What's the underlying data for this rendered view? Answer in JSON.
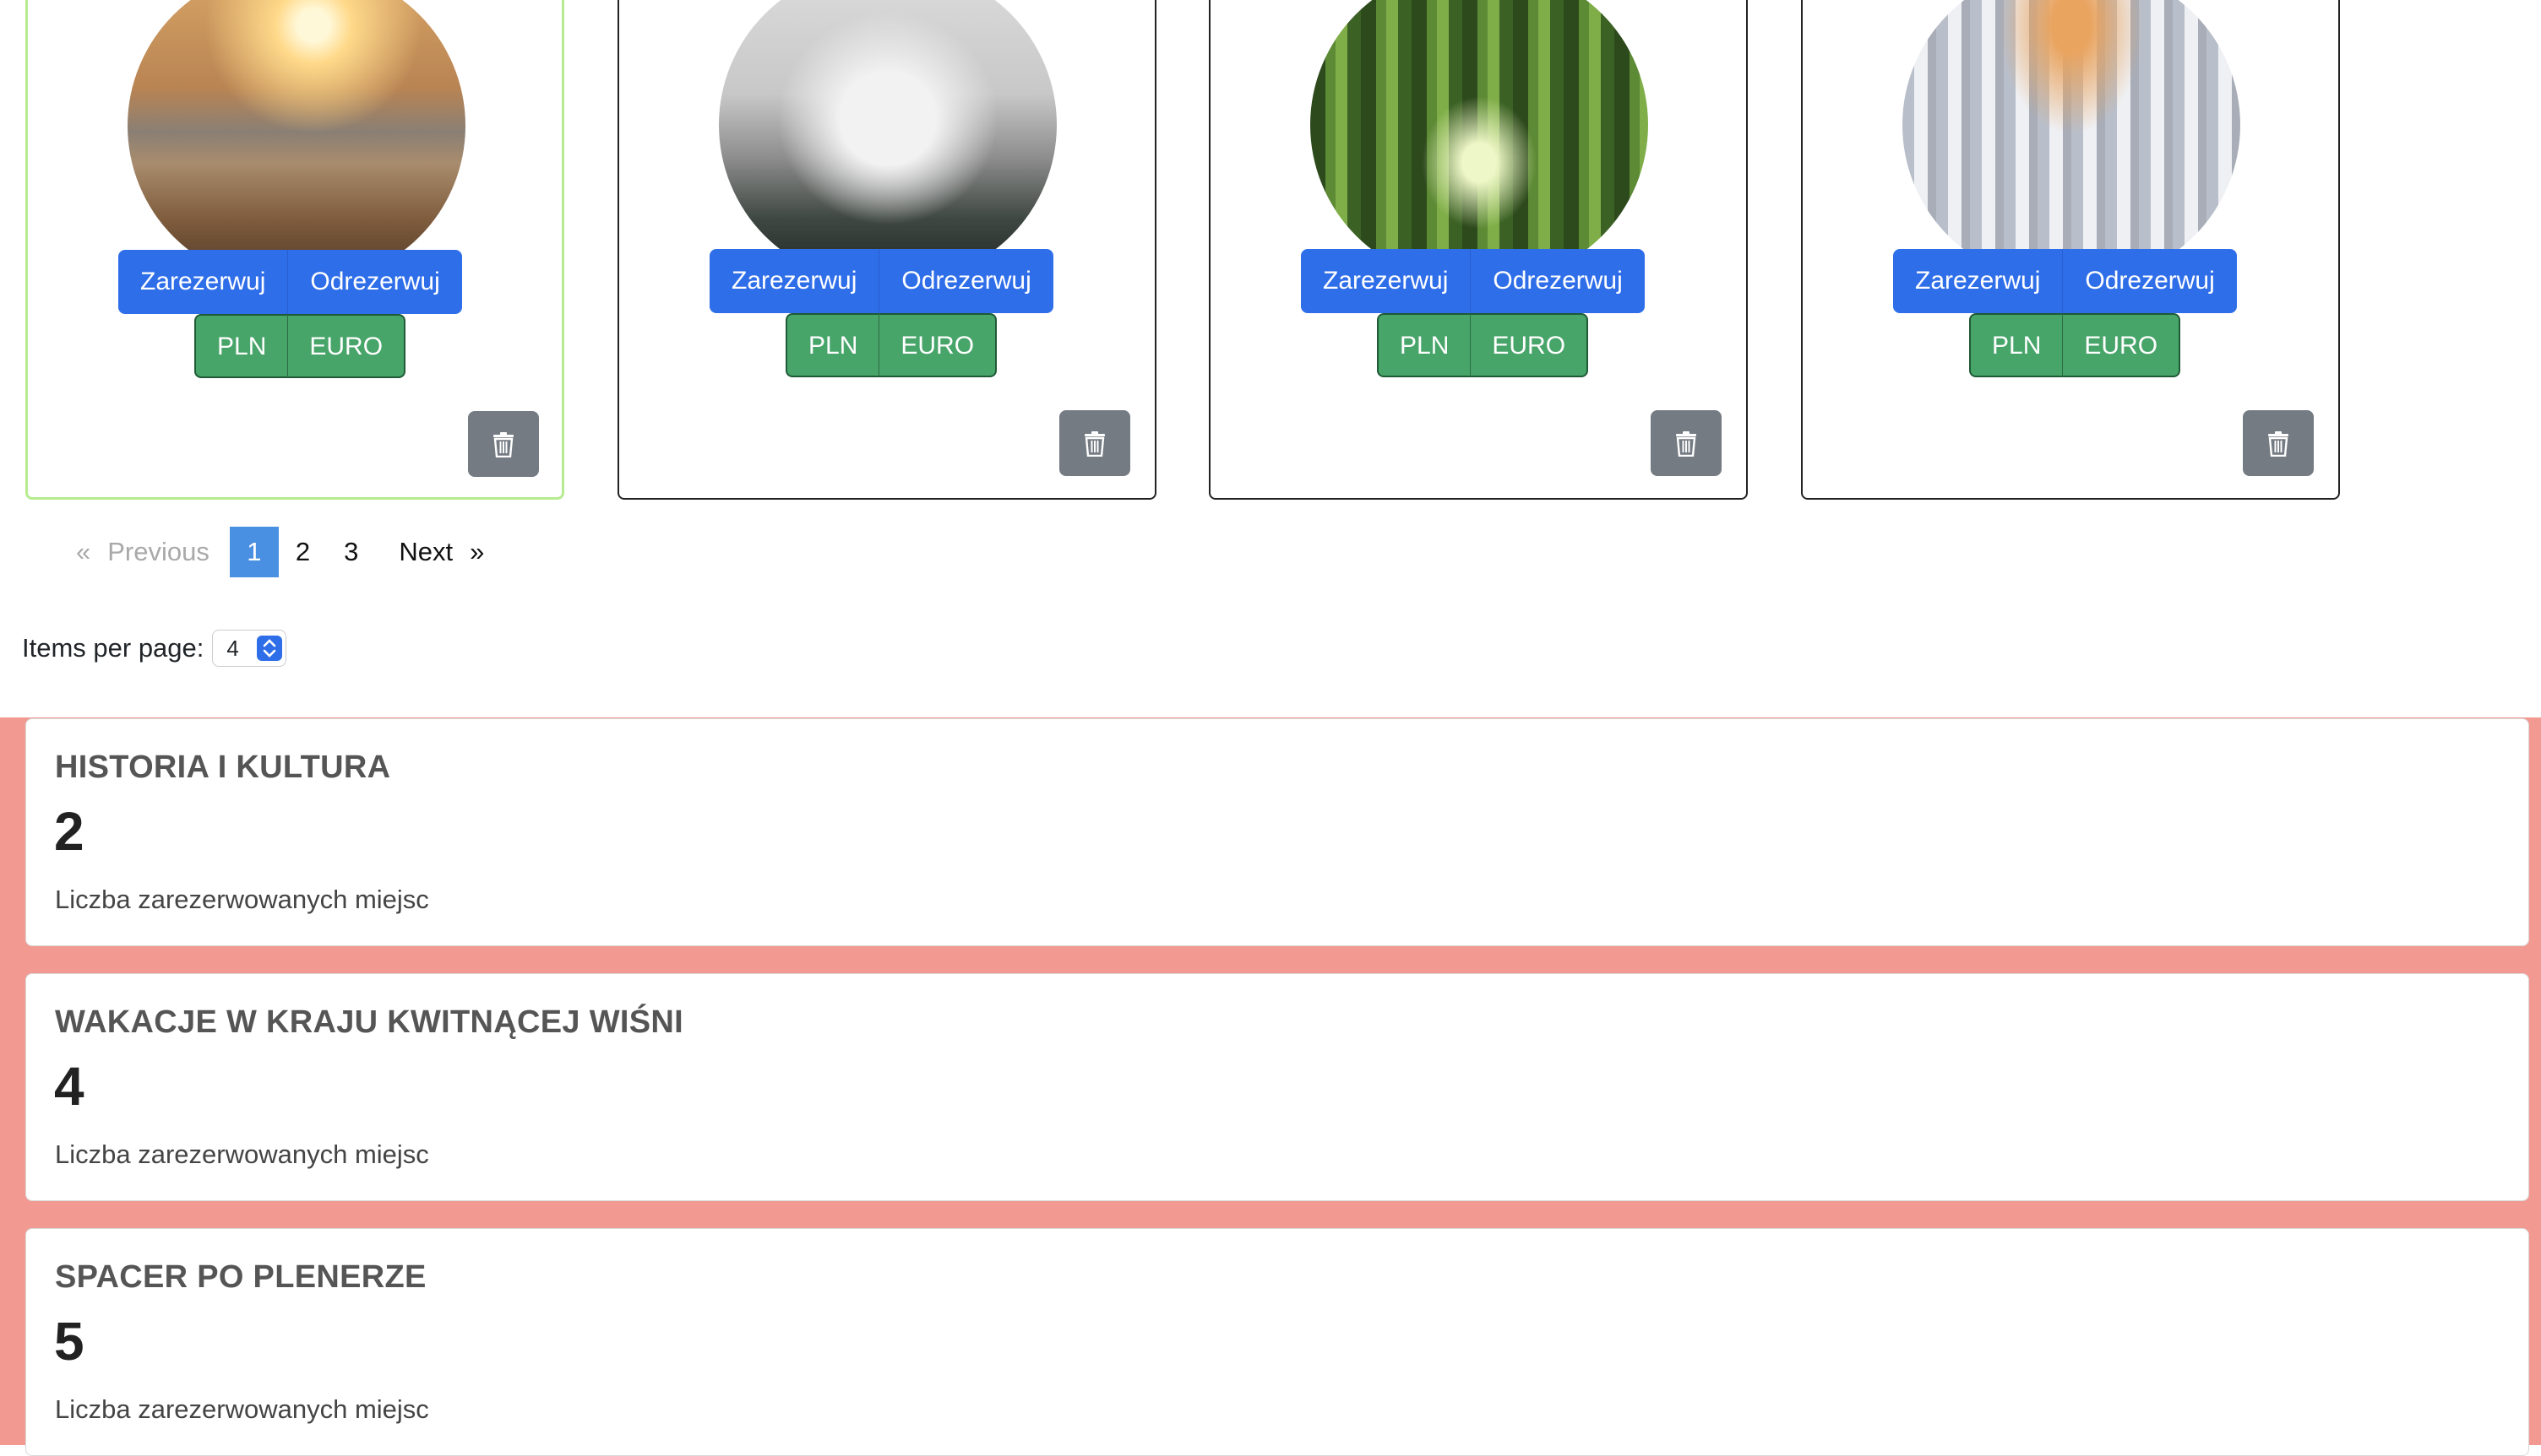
{
  "trips": [
    {
      "photo": "beach-sunset-photo",
      "reserve_label": "Zarezerwuj",
      "unreserve_label": "Odrezerwuj",
      "currency_pln": "PLN",
      "currency_euro": "EURO",
      "selected": true
    },
    {
      "photo": "snowy-mountain-forest-photo",
      "reserve_label": "Zarezerwuj",
      "unreserve_label": "Odrezerwuj",
      "currency_pln": "PLN",
      "currency_euro": "EURO",
      "selected": false
    },
    {
      "photo": "bamboo-forest-photo",
      "reserve_label": "Zarezerwuj",
      "unreserve_label": "Odrezerwuj",
      "currency_pln": "PLN",
      "currency_euro": "EURO",
      "selected": false
    },
    {
      "photo": "church-interior-photo",
      "reserve_label": "Zarezerwuj",
      "unreserve_label": "Odrezerwuj",
      "currency_pln": "PLN",
      "currency_euro": "EURO",
      "selected": false
    }
  ],
  "pagination": {
    "prev_symbol": "«",
    "prev_label": "Previous",
    "pages": [
      "1",
      "2",
      "3"
    ],
    "active_page": "1",
    "next_label": "Next",
    "next_symbol": "»"
  },
  "items_per_page": {
    "label": "Items per page:",
    "value": "4"
  },
  "summary": [
    {
      "title": "HISTORIA I KULTURA",
      "count": "2",
      "label": "Liczba zarezerwowanych miejsc"
    },
    {
      "title": "WAKACJE W KRAJU KWITNĄCEJ WIŚNI",
      "count": "4",
      "label": "Liczba zarezerwowanych miejsc"
    },
    {
      "title": "SPACER PO PLENERZE",
      "count": "5",
      "label": "Liczba zarezerwowanych miejsc"
    }
  ],
  "colors": {
    "primary": "#2f6ee9",
    "success": "#48a56a",
    "secondary": "#747b83",
    "selected_border": "#b6ec8f",
    "summary_background": "#f29a91",
    "active_page": "#4a90e2"
  }
}
